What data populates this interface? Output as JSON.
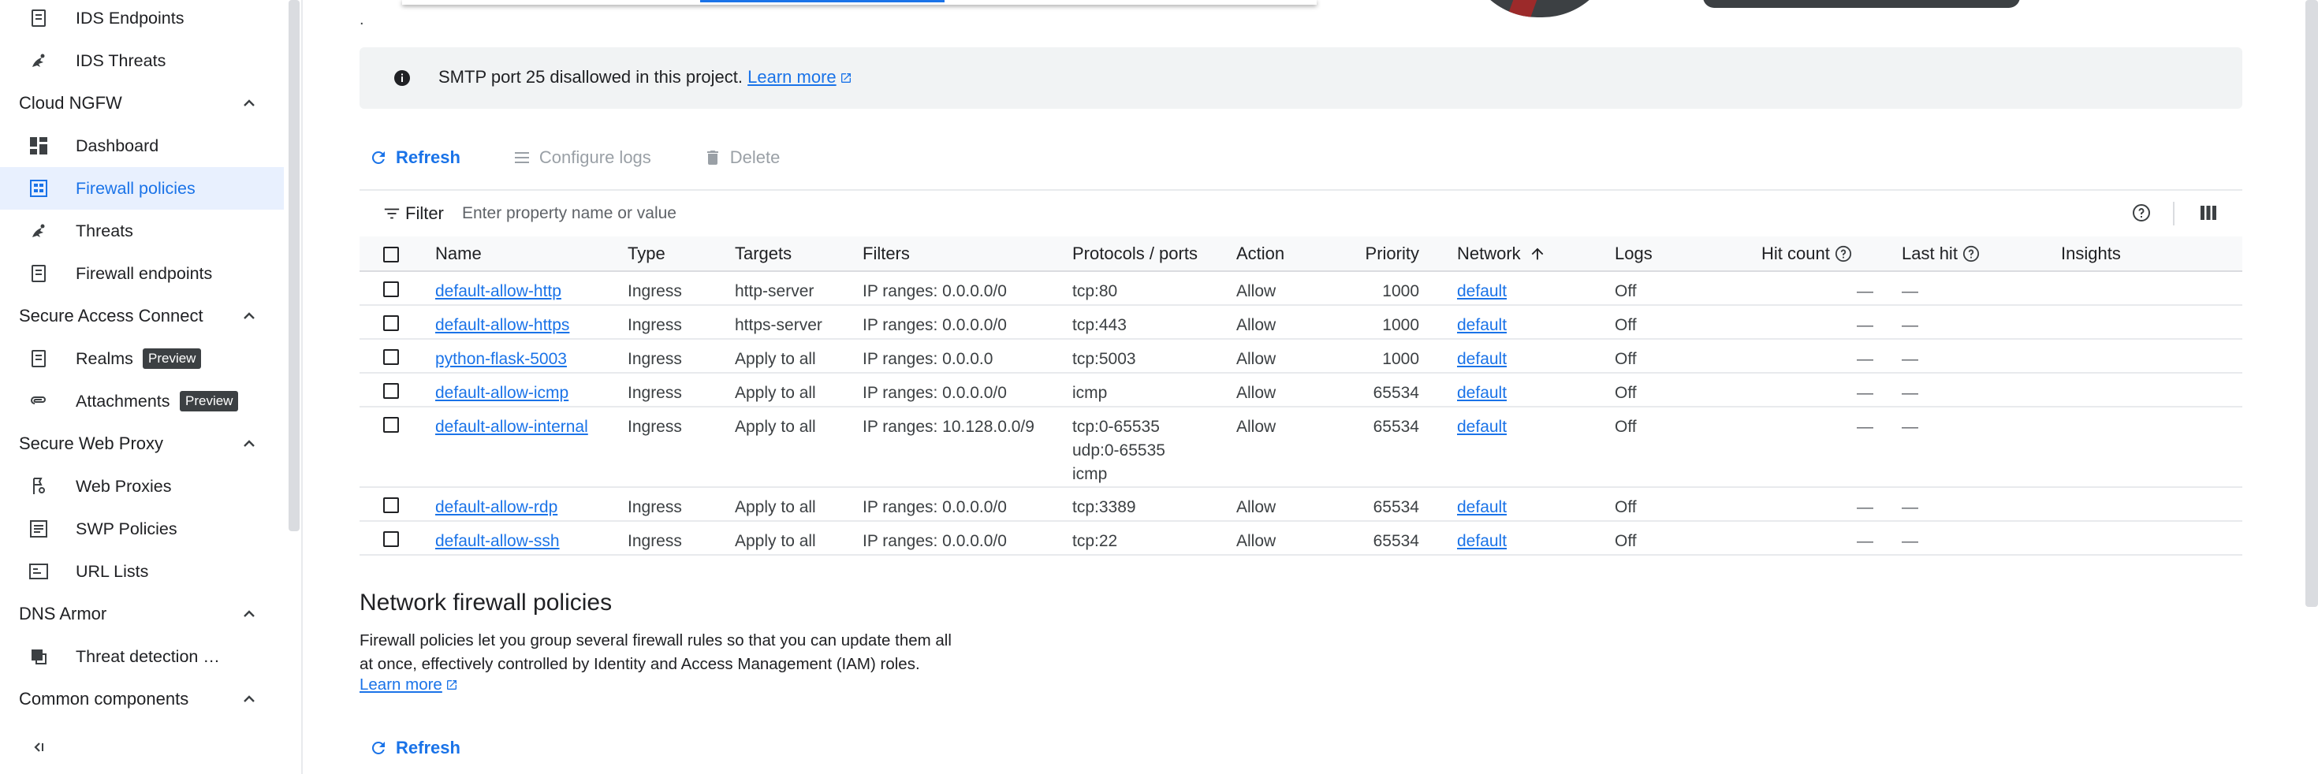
{
  "sidebar": {
    "items": [
      {
        "type": "item",
        "label": "IDS Endpoints",
        "icon": "endpoints-icon",
        "top": 0
      },
      {
        "type": "item",
        "label": "IDS Threats",
        "icon": "threats-icon"
      },
      {
        "type": "section",
        "label": "Cloud NGFW"
      },
      {
        "type": "item",
        "label": "Dashboard",
        "icon": "dashboard-icon"
      },
      {
        "type": "item",
        "label": "Firewall policies",
        "icon": "firewall-policies-icon",
        "active": true
      },
      {
        "type": "item",
        "label": "Threats",
        "icon": "threats-icon"
      },
      {
        "type": "item",
        "label": "Firewall endpoints",
        "icon": "endpoints-icon"
      },
      {
        "type": "section",
        "label": "Secure Access Connect"
      },
      {
        "type": "item",
        "label": "Realms",
        "icon": "endpoints-icon",
        "badge": "Preview"
      },
      {
        "type": "item",
        "label": "Attachments",
        "icon": "attachment-icon",
        "badge": "Preview"
      },
      {
        "type": "section",
        "label": "Secure Web Proxy"
      },
      {
        "type": "item",
        "label": "Web Proxies",
        "icon": "web-proxy-icon"
      },
      {
        "type": "item",
        "label": "SWP Policies",
        "icon": "policy-icon"
      },
      {
        "type": "item",
        "label": "URL Lists",
        "icon": "url-list-icon"
      },
      {
        "type": "section",
        "label": "DNS Armor"
      },
      {
        "type": "item",
        "label": "Threat detection …",
        "icon": "threat-detection-icon"
      },
      {
        "type": "section",
        "label": "Common components"
      }
    ]
  },
  "top_dot": ".",
  "banner": {
    "text": "SMTP port 25 disallowed in this project.",
    "link": "Learn more"
  },
  "toolbar": {
    "refresh": "Refresh",
    "configure_logs": "Configure logs",
    "delete": "Delete"
  },
  "filter": {
    "label": "Filter",
    "placeholder": "Enter property name or value"
  },
  "table": {
    "headers": {
      "name": "Name",
      "type": "Type",
      "targets": "Targets",
      "filters": "Filters",
      "protocols": "Protocols / ports",
      "action": "Action",
      "priority": "Priority",
      "network": "Network",
      "logs": "Logs",
      "hit_count": "Hit count",
      "last_hit": "Last hit",
      "insights": "Insights"
    },
    "rows": [
      {
        "name": "default-allow-http",
        "type": "Ingress",
        "targets": "http-server",
        "filters": "IP ranges: 0.0.0.0/0",
        "protocols": [
          "tcp:80"
        ],
        "action": "Allow",
        "priority": "1000",
        "network": "default",
        "logs": "Off",
        "hit_count": "—",
        "last_hit": "—"
      },
      {
        "name": "default-allow-https",
        "type": "Ingress",
        "targets": "https-server",
        "filters": "IP ranges: 0.0.0.0/0",
        "protocols": [
          "tcp:443"
        ],
        "action": "Allow",
        "priority": "1000",
        "network": "default",
        "logs": "Off",
        "hit_count": "—",
        "last_hit": "—"
      },
      {
        "name": "python-flask-5003",
        "type": "Ingress",
        "targets": "Apply to all",
        "filters": "IP ranges: 0.0.0.0",
        "protocols": [
          "tcp:5003"
        ],
        "action": "Allow",
        "priority": "1000",
        "network": "default",
        "logs": "Off",
        "hit_count": "—",
        "last_hit": "—"
      },
      {
        "name": "default-allow-icmp",
        "type": "Ingress",
        "targets": "Apply to all",
        "filters": "IP ranges: 0.0.0.0/0",
        "protocols": [
          "icmp"
        ],
        "action": "Allow",
        "priority": "65534",
        "network": "default",
        "logs": "Off",
        "hit_count": "—",
        "last_hit": "—"
      },
      {
        "name": "default-allow-internal",
        "type": "Ingress",
        "targets": "Apply to all",
        "filters": "IP ranges: 10.128.0.0/9",
        "protocols": [
          "tcp:0-65535",
          "udp:0-65535",
          "icmp"
        ],
        "action": "Allow",
        "priority": "65534",
        "network": "default",
        "logs": "Off",
        "hit_count": "—",
        "last_hit": "—"
      },
      {
        "name": "default-allow-rdp",
        "type": "Ingress",
        "targets": "Apply to all",
        "filters": "IP ranges: 0.0.0.0/0",
        "protocols": [
          "tcp:3389"
        ],
        "action": "Allow",
        "priority": "65534",
        "network": "default",
        "logs": "Off",
        "hit_count": "—",
        "last_hit": "—"
      },
      {
        "name": "default-allow-ssh",
        "type": "Ingress",
        "targets": "Apply to all",
        "filters": "IP ranges: 0.0.0.0/0",
        "protocols": [
          "tcp:22"
        ],
        "action": "Allow",
        "priority": "65534",
        "network": "default",
        "logs": "Off",
        "hit_count": "—",
        "last_hit": "—"
      }
    ]
  },
  "network_policies": {
    "title": "Network firewall policies",
    "description_line1": "Firewall policies let you group several firewall rules so that you can update them all",
    "description_line2": "at once, effectively controlled by Identity and Access Management (IAM) roles.",
    "link": "Learn more",
    "refresh": "Refresh"
  },
  "colors": {
    "accent": "#1a73e8",
    "active_bg": "#e8f0fe",
    "banner_bg": "#f1f3f4",
    "header_bg": "#f8f9fa"
  }
}
